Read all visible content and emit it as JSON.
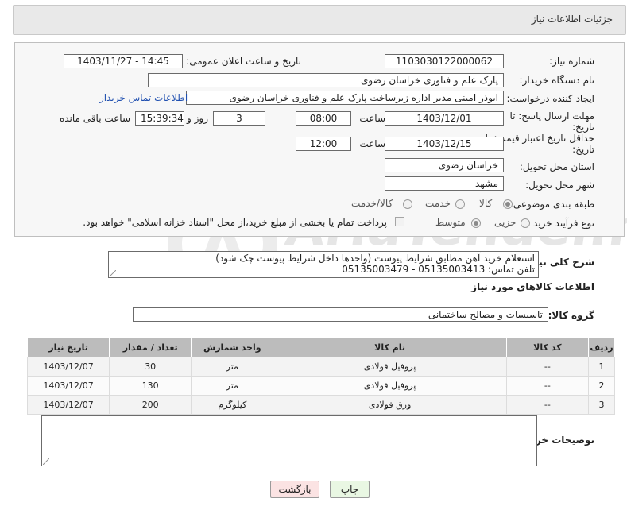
{
  "header": {
    "title": "جزئیات اطلاعات نیاز"
  },
  "form": {
    "need_number_label": "شماره نیاز:",
    "need_number": "1103030122000062",
    "announce_label": "تاریخ و ساعت اعلان عمومی:",
    "announce_value": "1403/11/27 - 14:45",
    "buyer_org_label": "نام دستگاه خریدار:",
    "buyer_org": "پارک علم و فناوری خراسان رضوی",
    "creator_label": "ایجاد کننده درخواست:",
    "creator": "ابوذر امینی مدیر اداره زیرساخت پارک علم و فناوری خراسان رضوی",
    "contact_link": "اطلاعات تماس خریدار",
    "reply_deadline_label_1": "مهلت ارسال پاسخ: تا",
    "reply_deadline_label_2": "تاریخ:",
    "reply_date": "1403/12/01",
    "time_label": "ساعت",
    "reply_time": "08:00",
    "days_value": "3",
    "days_label": "روز و",
    "remaining_time": "15:39:34",
    "remaining_label": "ساعت باقی مانده",
    "validity_label_1": "حداقل تاریخ اعتبار قیمت: تا",
    "validity_label_2": "تاریخ:",
    "validity_date": "1403/12/15",
    "validity_time": "12:00",
    "province_label": "استان محل تحویل:",
    "province": "خراسان رضوی",
    "city_label": "شهر محل تحویل:",
    "city": "مشهد",
    "category_label": "طبقه بندی موضوعی:",
    "category_options": [
      "کالا",
      "خدمت",
      "کالا/خدمت"
    ],
    "process_label": "نوع فرآیند خرید :",
    "process_options": [
      "جزیی",
      "متوسط"
    ],
    "payment_note": "پرداخت تمام یا بخشی از مبلغ خرید،از محل \"اسناد خزانه اسلامی\" خواهد بود."
  },
  "description": {
    "label": "شرح کلی نیاز:",
    "line1": "استعلام خرید آهن مطابق شرایط پیوست (واحدها داخل شرایط پیوست چک شود)",
    "line2": "تلفن تماس: 05135003413 - 05135003479"
  },
  "goods": {
    "section_title": "اطلاعات کالاهای مورد نیاز",
    "group_label": "گروه کالا:",
    "group_value": "تاسیسات و مصالح ساختمانی",
    "columns": [
      "ردیف",
      "کد کالا",
      "نام کالا",
      "واحد شمارش",
      "تعداد / مقدار",
      "تاریخ نیاز"
    ],
    "rows": [
      {
        "row": "1",
        "code": "--",
        "name": "پروفیل فولادی",
        "unit": "متر",
        "qty": "30",
        "date": "1403/12/07"
      },
      {
        "row": "2",
        "code": "--",
        "name": "پروفیل فولادی",
        "unit": "متر",
        "qty": "130",
        "date": "1403/12/07"
      },
      {
        "row": "3",
        "code": "--",
        "name": "ورق فولادی",
        "unit": "کیلوگرم",
        "qty": "200",
        "date": "1403/12/07"
      }
    ]
  },
  "buyer_notes": {
    "label": "توضیحات خریدار:",
    "value": ""
  },
  "buttons": {
    "print": "چاپ",
    "back": "بازگشت"
  },
  "watermark": {
    "text": "AriaTender.net"
  },
  "colors": {
    "header_bg": "#e9e9e9",
    "table_header_bg": "#bcbcbc",
    "link": "#1f4fb0",
    "print_btn": "#e9f7e3",
    "back_btn": "#fbe3e3"
  }
}
